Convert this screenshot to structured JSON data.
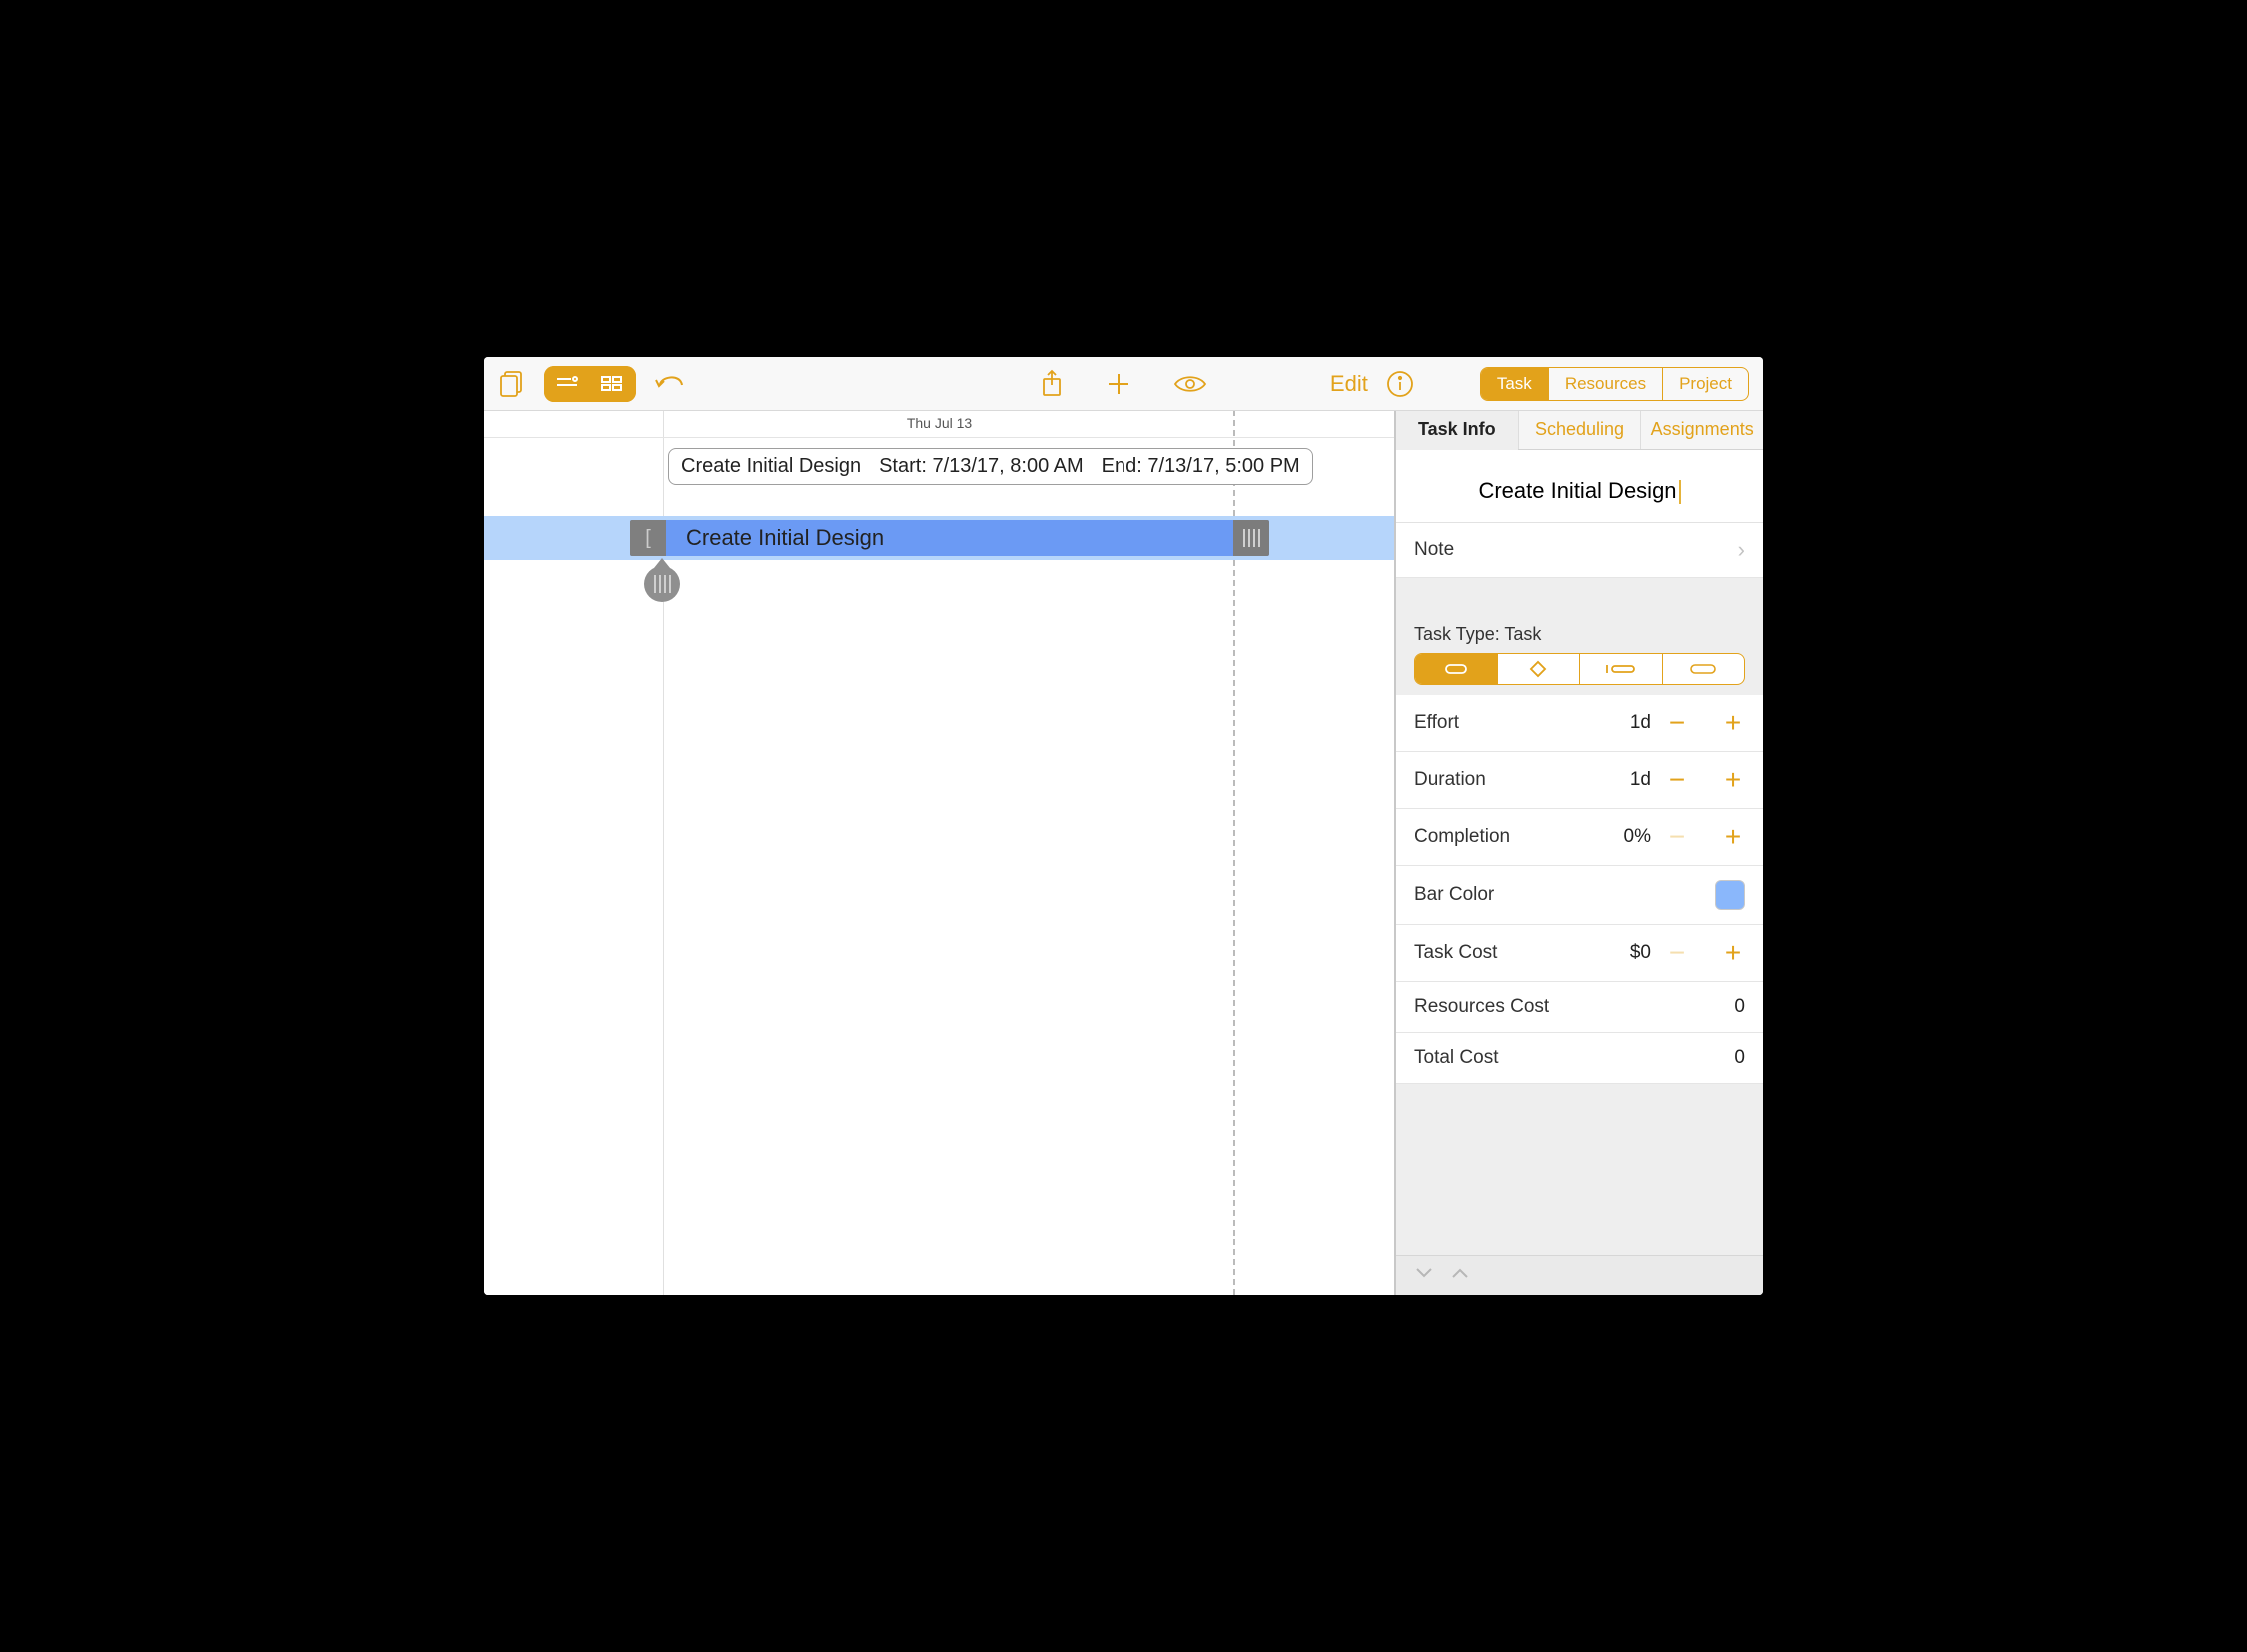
{
  "toolbar": {
    "edit_label": "Edit",
    "segments": {
      "task": "Task",
      "resources": "Resources",
      "project": "Project"
    }
  },
  "gantt": {
    "date_header": "Thu Jul 13",
    "tooltip": {
      "name": "Create Initial Design",
      "start": "Start: 7/13/17, 8:00 AM",
      "end": "End: 7/13/17, 5:00 PM"
    },
    "task_bar_label": "Create Initial Design"
  },
  "inspector": {
    "tabs": {
      "info": "Task Info",
      "scheduling": "Scheduling",
      "assignments": "Assignments"
    },
    "title": "Create Initial Design",
    "note_label": "Note",
    "task_type_label": "Task Type: Task",
    "effort": {
      "label": "Effort",
      "value": "1d"
    },
    "duration": {
      "label": "Duration",
      "value": "1d"
    },
    "completion": {
      "label": "Completion",
      "value": "0%"
    },
    "bar_color_label": "Bar Color",
    "bar_color_value": "#8ab7fb",
    "task_cost": {
      "label": "Task Cost",
      "value": "$0"
    },
    "resources_cost": {
      "label": "Resources Cost",
      "value": "0"
    },
    "total_cost": {
      "label": "Total Cost",
      "value": "0"
    }
  }
}
